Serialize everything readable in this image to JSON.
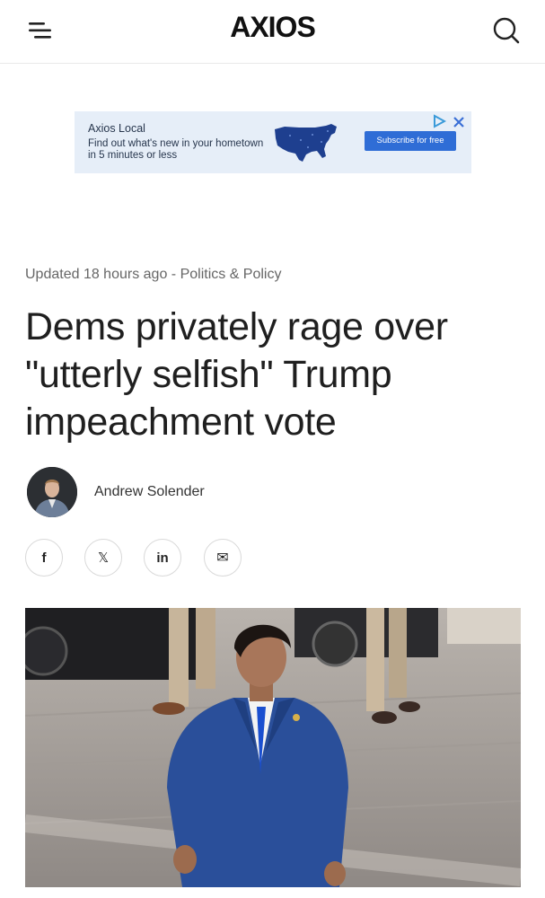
{
  "header": {
    "logo_text": "AXIOS",
    "menu_icon": "menu-icon",
    "search_icon": "search-icon"
  },
  "ad": {
    "title": "Axios Local",
    "subtitle": "Find out what's new in your hometown in 5 minutes or less",
    "cta": "Subscribe for free",
    "map_icon": "us-map-icon",
    "adchoices_icon": "adchoices-icon",
    "close_icon": "close-icon"
  },
  "article": {
    "updated": "Updated 18 hours ago",
    "separator": " - ",
    "category": "Politics & Policy",
    "headline": "Dems privately rage over \"utterly selfish\" Trump impeachment vote",
    "author": "Andrew Solender"
  },
  "share": [
    {
      "icon": "facebook-icon",
      "glyph": "f"
    },
    {
      "icon": "x-icon",
      "glyph": "𝕏"
    },
    {
      "icon": "linkedin-icon",
      "glyph": "in"
    },
    {
      "icon": "email-icon",
      "glyph": "✉"
    }
  ],
  "colors": {
    "ad_background": "#e6eef8",
    "ad_cta": "#2f6dd6",
    "suit_blue": "#2a4f9a",
    "tie_blue": "#1a4fd0"
  }
}
